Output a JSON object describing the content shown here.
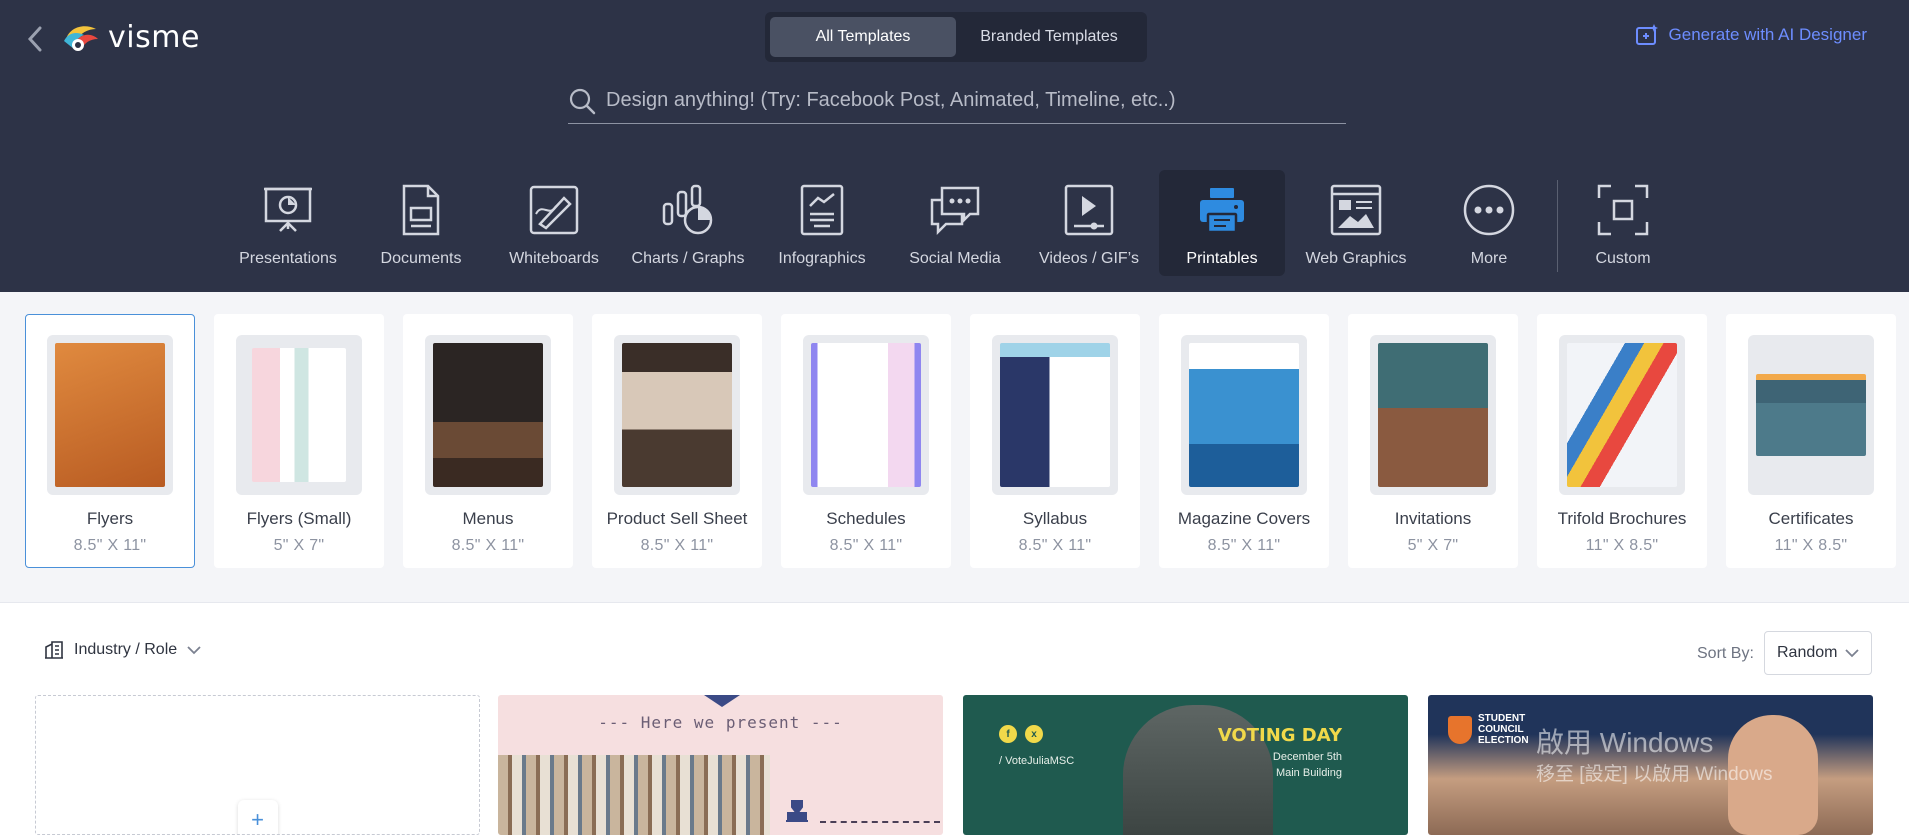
{
  "app": {
    "logo_text": "visme",
    "back_label": "Back"
  },
  "header": {
    "tabs": [
      {
        "label": "All Templates",
        "active": true
      },
      {
        "label": "Branded Templates",
        "active": false
      }
    ],
    "ai_button": "Generate with AI Designer",
    "search_placeholder": "Design anything! (Try: Facebook Post, Animated, Timeline, etc..)"
  },
  "categories": [
    {
      "label": "Presentations",
      "icon": "presentation-icon"
    },
    {
      "label": "Documents",
      "icon": "document-icon"
    },
    {
      "label": "Whiteboards",
      "icon": "whiteboard-icon"
    },
    {
      "label": "Charts / Graphs",
      "icon": "chart-icon"
    },
    {
      "label": "Infographics",
      "icon": "infographic-icon"
    },
    {
      "label": "Social Media",
      "icon": "social-media-icon"
    },
    {
      "label": "Videos / GIF’s",
      "icon": "video-icon"
    },
    {
      "label": "Printables",
      "icon": "printer-icon",
      "active": true
    },
    {
      "label": "Web Graphics",
      "icon": "web-graphics-icon"
    },
    {
      "label": "More",
      "icon": "more-icon"
    },
    {
      "label": "Custom",
      "icon": "custom-size-icon"
    }
  ],
  "subcategories": [
    {
      "name": "Flyers",
      "size": "8.5\" X 11\"",
      "color": "#d8732f",
      "active": true
    },
    {
      "name": "Flyers (Small)",
      "size": "5\" X 7\"",
      "color": "#f3f3f3"
    },
    {
      "name": "Menus",
      "size": "8.5\" X 11\"",
      "color": "#2b2523"
    },
    {
      "name": "Product Sell Sheet",
      "size": "8.5\" X 11\"",
      "color": "#4a3a30"
    },
    {
      "name": "Schedules",
      "size": "8.5\" X 11\"",
      "color": "#8f86f0"
    },
    {
      "name": "Syllabus",
      "size": "8.5\" X 11\"",
      "color": "#2a3768"
    },
    {
      "name": "Magazine Covers",
      "size": "8.5\" X 11\"",
      "color": "#3a91d0"
    },
    {
      "name": "Invitations",
      "size": "5\" X 7\"",
      "color": "#3f6d74"
    },
    {
      "name": "Trifold Brochures",
      "size": "11\" X 8.5\"",
      "color": "#f2f4f8"
    },
    {
      "name": "Certificates",
      "size": "11\" X 8.5\"",
      "color": "#3e6475"
    }
  ],
  "filters": {
    "industry_label": "Industry / Role",
    "sort_by_label": "Sort By:",
    "sort_value": "Random"
  },
  "cards": {
    "blank_plus": "+",
    "pink_title": "--- Here we present ---",
    "voting": {
      "handle": "/ VoteJuliaMSC",
      "title": "VOTING DAY",
      "date_line1": "December 5th",
      "date_line2": "Main Building"
    },
    "student": {
      "badge_line1": "STUDENT",
      "badge_line2": "COUNCIL",
      "badge_line3": "ELECTION",
      "watermark1": "啟用 Windows",
      "watermark2": "移至 [設定] 以啟用 Windows"
    }
  }
}
